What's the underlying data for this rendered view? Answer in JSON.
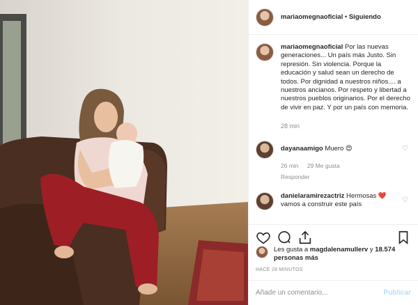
{
  "header": {
    "username": "mariaomegnaoficial",
    "separator": "•",
    "follow_status": "Siguiendo"
  },
  "caption": {
    "username": "mariaomegnaoficial",
    "text": "Por las nuevas generaciones... Un país más Justo. Sin represión. Sin violencia. Porque la educación y salud sean un derecho de todos. Por dignidad a nuestros niños.... a nuestros ancianos. Por respeto y libertad a nuestros pueblos originarios. Por el derecho de vivir en paz. Y por un país con memoria.",
    "time": "28 min"
  },
  "comments": [
    {
      "username": "dayanaamigo",
      "text": "Muero 😍",
      "time": "26 min",
      "likes": "29 Me gusta",
      "reply": "Responder"
    },
    {
      "username": "danielaramirezactriz",
      "text": "Hermosas ❤️ vamos a construir este país"
    }
  ],
  "likes": {
    "prefix": "Les gusta a",
    "user": "magdalenamullerv",
    "connector": "y",
    "count": "18.574 personas más"
  },
  "posted_ago": "HACE 28 MINUTOS",
  "add_comment": {
    "placeholder": "Añade un comentario...",
    "publish": "Publicar"
  },
  "icons": [
    "heart-icon",
    "comment-icon",
    "share-icon",
    "bookmark-icon"
  ],
  "colors": {
    "accent_disabled": "#b2dffc",
    "muted": "#8e8e8e",
    "text": "#262626"
  }
}
